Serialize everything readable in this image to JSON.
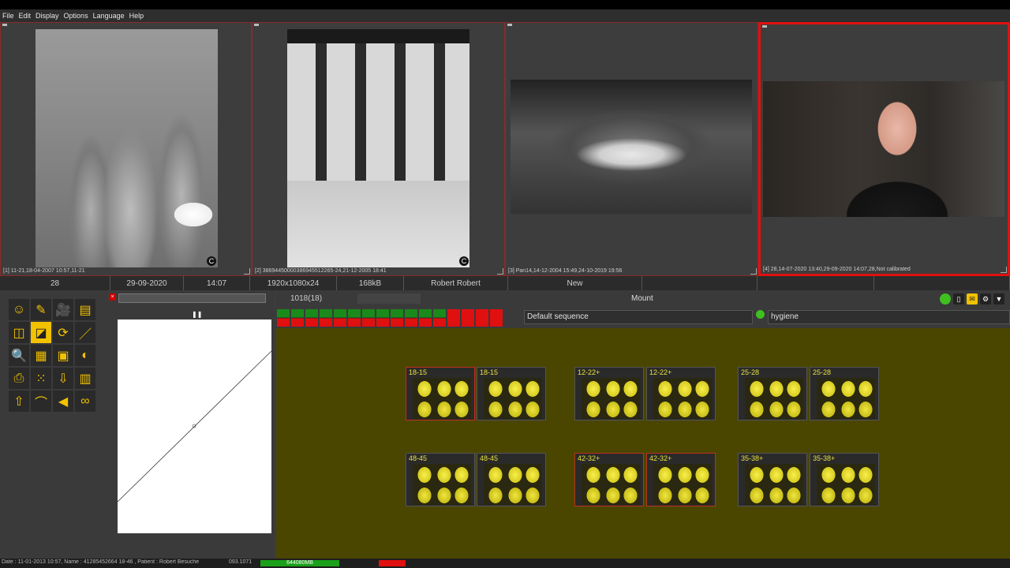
{
  "menu": [
    "File",
    "Edit",
    "Display",
    "Options",
    "Language",
    "Help"
  ],
  "viewers": [
    {
      "caption": "[1] 11-21,18-04-2007 10:57,11-21"
    },
    {
      "caption": "[2] 38694450000386945512265-24,21-12-2005 18:41"
    },
    {
      "caption": "[3] Pan14,14-12-2004 15:49,24-10-2019 19:56"
    },
    {
      "caption": "[4] 28,14-07-2020 13:40,29-09-2020 14:07,28,Not calibrated"
    }
  ],
  "status": {
    "count": "28",
    "date": "29-09-2020",
    "time": "14:07",
    "resolution": "1920x1080x24",
    "size": "168kB",
    "patient": "Robert Robert",
    "state": "New"
  },
  "mount": {
    "id": "1018(18)",
    "title": "Mount",
    "sequence": "Default sequence",
    "template": "hygiene"
  },
  "sequence_cells": [
    "g",
    "g",
    "g",
    "g",
    "g",
    "g",
    "g",
    "g",
    "g",
    "g",
    "g",
    "g",
    "r",
    "r",
    "r",
    "r"
  ],
  "thumbs": [
    {
      "label": "18-15"
    },
    {
      "label": "18-15"
    },
    {
      "label": "12-22+"
    },
    {
      "label": "12-22+"
    },
    {
      "label": "25-28"
    },
    {
      "label": "25-28"
    },
    {
      "label": "48-45"
    },
    {
      "label": "48-45"
    },
    {
      "label": "42-32+"
    },
    {
      "label": "42-32+"
    },
    {
      "label": "35-38+"
    },
    {
      "label": "35-38+"
    }
  ],
  "bottom": {
    "info": "Date : 11-01-2013 10:57, Name : 41285452664 18-46 , Patient : Robert Besuche",
    "field": "093.1071",
    "memory": "644080MB"
  },
  "colors": {
    "accent": "#e01010",
    "mount_bg": "#4a4600",
    "tooth": "#f8ef4c"
  }
}
